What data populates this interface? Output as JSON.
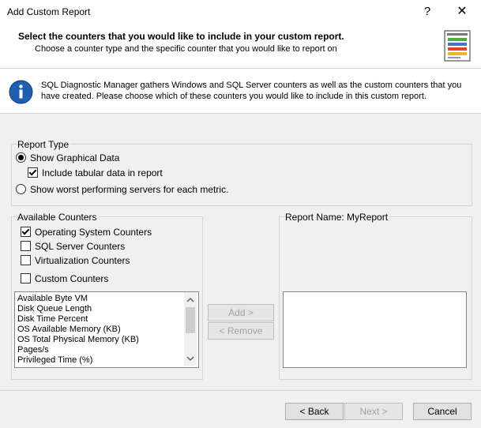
{
  "window": {
    "title": "Add Custom Report",
    "help_glyph": "?",
    "close_glyph": "✕"
  },
  "header": {
    "title": "Select the counters that you would like to include in your custom report.",
    "subtitle": "Choose a counter type and the specific counter that you would like to report on",
    "icon": "report-list-icon"
  },
  "info": {
    "icon": "info-icon",
    "text": "SQL Diagnostic Manager gathers Windows and SQL Server counters as well as the custom counters that you have created.  Please choose which of these counters you would like to include in this custom report."
  },
  "report_type": {
    "label": "Report Type",
    "show_graphical": {
      "label": "Show Graphical Data",
      "selected": true
    },
    "include_tabular": {
      "label": "Include tabular data in report",
      "checked": true
    },
    "show_worst": {
      "label": "Show worst performing servers for each metric.",
      "selected": false
    }
  },
  "available_counters": {
    "label": "Available Counters",
    "options": [
      {
        "label": "Operating System Counters",
        "checked": true
      },
      {
        "label": "SQL Server Counters",
        "checked": false
      },
      {
        "label": "Virtualization Counters",
        "checked": false
      },
      {
        "label": "Custom Counters",
        "checked": false
      }
    ],
    "list": [
      "Available Byte VM",
      "Disk Queue Length",
      "Disk Time Percent",
      "OS Available Memory (KB)",
      "OS Total Physical Memory (KB)",
      "Pages/s",
      "Privileged Time (%)"
    ]
  },
  "actions": {
    "add": "Add >",
    "remove": "< Remove"
  },
  "report_name": {
    "label": "Report Name: MyReport"
  },
  "footer": {
    "back": "< Back",
    "next": "Next >",
    "cancel": "Cancel"
  },
  "colors": {
    "info_blue": "#1f5fb0",
    "background": "#f0f0f0"
  }
}
